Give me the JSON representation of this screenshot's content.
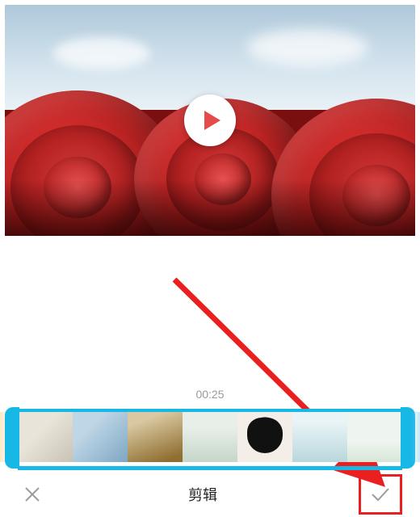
{
  "preview": {
    "play_icon": "play-icon"
  },
  "timeline": {
    "timestamp": "00:25",
    "thumbs": [
      "t0",
      "t1",
      "t2",
      "t3",
      "t4",
      "t5",
      "t6"
    ]
  },
  "bottombar": {
    "cancel_icon": "close-icon",
    "title": "剪辑",
    "confirm_icon": "check-icon"
  },
  "colors": {
    "accent": "#17b7e6",
    "annotation": "#ea1f1f"
  }
}
